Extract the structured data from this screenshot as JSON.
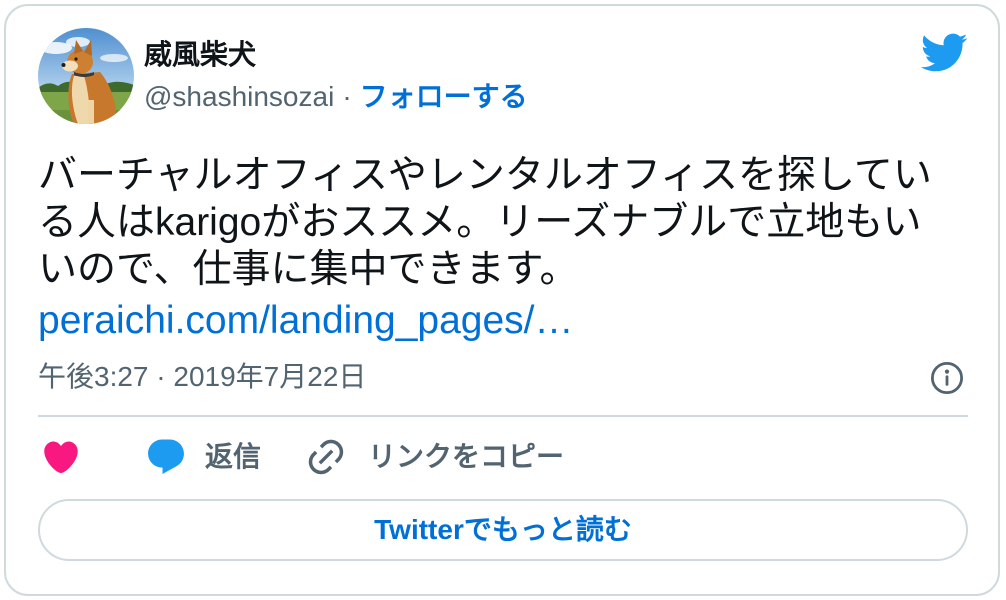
{
  "tweet": {
    "author": {
      "name": "威風柴犬",
      "handle": "@shashinsozai",
      "separator": "·",
      "follow_label": "フォローする"
    },
    "text": "バーチャルオフィスやレンタルオフィスを探している人はkarigoがおススメ。リーズナブルで立地もいいので、仕事に集中できます。",
    "link_text": "peraichi.com/landing_pages/…",
    "timestamp": "午後3:27 · 2019年7月22日"
  },
  "actions": {
    "reply_label": "返信",
    "copy_link_label": "リンクをコピー"
  },
  "read_more_label": "Twitterでもっと読む",
  "icons": {
    "brand": "twitter-bird-icon",
    "info": "info-icon",
    "like": "heart-icon",
    "reply": "speech-bubble-icon",
    "copy_link": "link-icon"
  },
  "colors": {
    "text": "#0f1419",
    "secondary_text": "#536471",
    "link": "#006fd6",
    "brand": "#1d9bf0",
    "like": "#f91880",
    "border": "#cfd9de"
  }
}
